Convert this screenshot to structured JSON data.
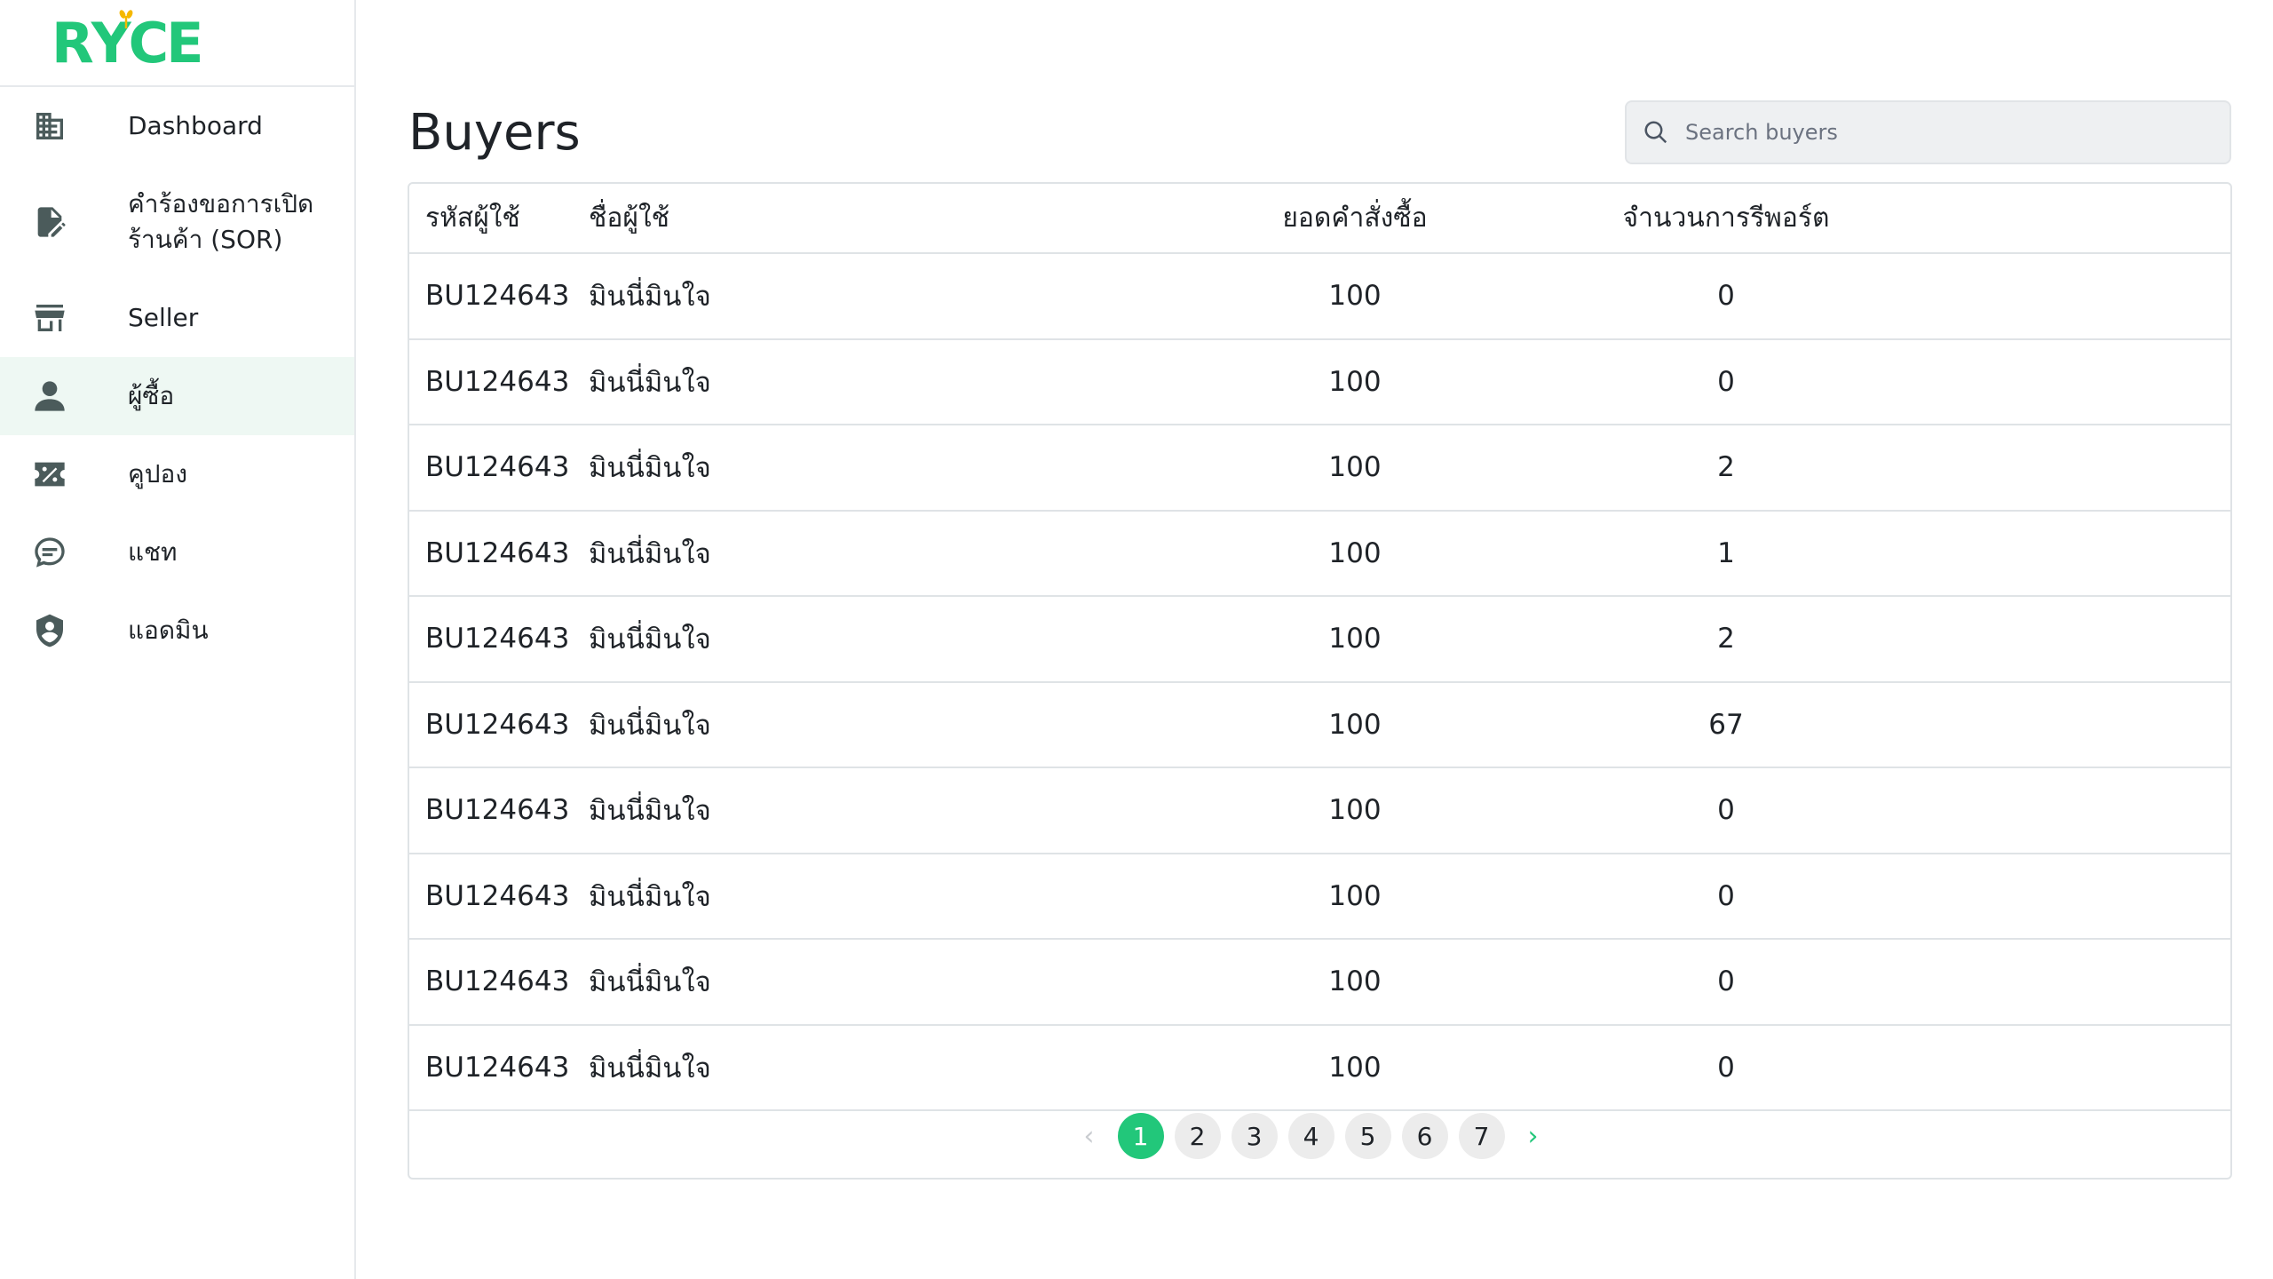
{
  "brand": {
    "logo_pre": "R",
    "logo_y": "Y",
    "logo_post": "CE",
    "color": "#22c77a"
  },
  "sidebar": {
    "items": [
      {
        "label": "Dashboard",
        "icon": "building-icon",
        "active": false
      },
      {
        "label": "คำร้องขอการเปิดร้านค้า (SOR)",
        "icon": "file-edit-icon",
        "active": false
      },
      {
        "label": "Seller",
        "icon": "store-icon",
        "active": false
      },
      {
        "label": "ผู้ซื้อ",
        "icon": "user-icon",
        "active": true
      },
      {
        "label": "คูปอง",
        "icon": "coupon-icon",
        "active": false
      },
      {
        "label": "แชท",
        "icon": "chat-icon",
        "active": false
      },
      {
        "label": "แอดมิน",
        "icon": "shield-user-icon",
        "active": false
      }
    ]
  },
  "main": {
    "title": "Buyers",
    "search": {
      "placeholder": "Search buyers",
      "value": ""
    }
  },
  "table": {
    "headers": {
      "id": "รหัสผู้ใช้",
      "name": "ชื่อผู้ใช้",
      "orders": "ยอดคำสั่งซื้อ",
      "reports": "จำนวนการรีพอร์ต"
    },
    "rows": [
      {
        "id": "BU124643",
        "name": "มินนี่มินใจ",
        "orders": "100",
        "reports": "0"
      },
      {
        "id": "BU124643",
        "name": "มินนี่มินใจ",
        "orders": "100",
        "reports": "0"
      },
      {
        "id": "BU124643",
        "name": "มินนี่มินใจ",
        "orders": "100",
        "reports": "2"
      },
      {
        "id": "BU124643",
        "name": "มินนี่มินใจ",
        "orders": "100",
        "reports": "1"
      },
      {
        "id": "BU124643",
        "name": "มินนี่มินใจ",
        "orders": "100",
        "reports": "2"
      },
      {
        "id": "BU124643",
        "name": "มินนี่มินใจ",
        "orders": "100",
        "reports": "67"
      },
      {
        "id": "BU124643",
        "name": "มินนี่มินใจ",
        "orders": "100",
        "reports": "0"
      },
      {
        "id": "BU124643",
        "name": "มินนี่มินใจ",
        "orders": "100",
        "reports": "0"
      },
      {
        "id": "BU124643",
        "name": "มินนี่มินใจ",
        "orders": "100",
        "reports": "0"
      },
      {
        "id": "BU124643",
        "name": "มินนี่มินใจ",
        "orders": "100",
        "reports": "0"
      }
    ]
  },
  "pagination": {
    "prev": "‹",
    "next": "›",
    "pages": [
      "1",
      "2",
      "3",
      "4",
      "5",
      "6",
      "7"
    ],
    "current": "1"
  }
}
